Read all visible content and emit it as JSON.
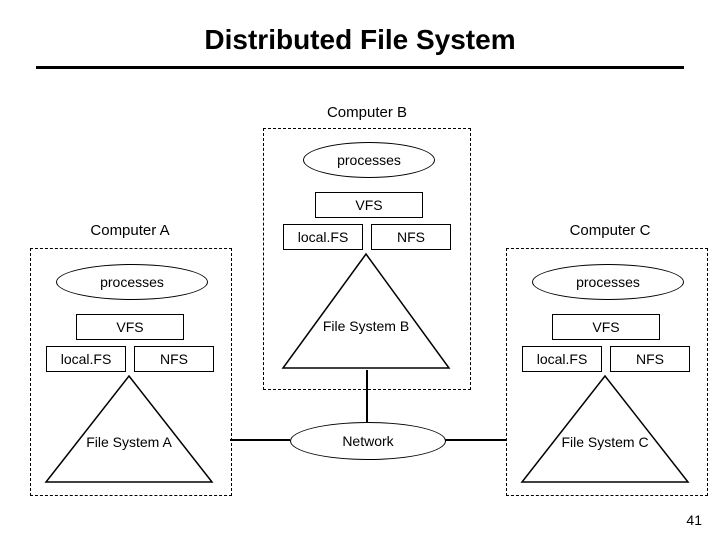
{
  "title": "Distributed File System",
  "page_number": "41",
  "labels": {
    "computer_a": "Computer A",
    "computer_b": "Computer B",
    "computer_c": "Computer C",
    "processes": "processes",
    "vfs": "VFS",
    "local_fs": "local.FS",
    "nfs": "NFS",
    "fs_a": "File\nSystem A",
    "fs_b": "File\nSystem B",
    "fs_c": "File\nSystem C",
    "network": "Network"
  }
}
